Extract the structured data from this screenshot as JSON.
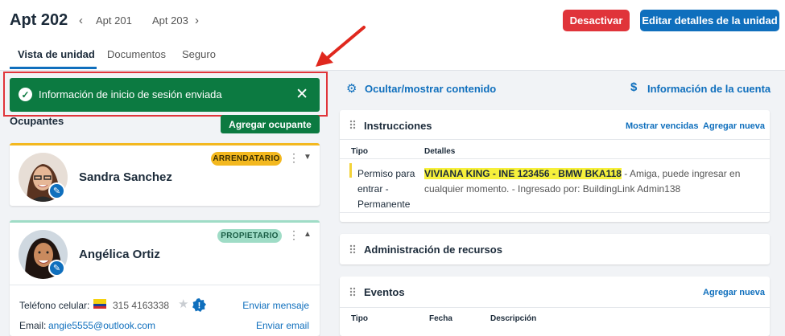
{
  "header": {
    "title": "Apt 202",
    "prev_unit": "Apt 201",
    "next_unit": "Apt 203",
    "deactivate_label": "Desactivar",
    "edit_label": "Editar detalles de la unidad"
  },
  "tabs": [
    {
      "label": "Vista de unidad",
      "active": true
    },
    {
      "label": "Documentos",
      "active": false
    },
    {
      "label": "Seguro",
      "active": false
    }
  ],
  "toast": {
    "message": "Información de inicio de sesión enviada",
    "close_icon": "close-icon"
  },
  "occupants": {
    "title": "Ocupantes",
    "add_label": "Agregar ocupante",
    "items": [
      {
        "name": "Sandra Sanchez",
        "role": "ARRENDATARIO",
        "expanded": false
      },
      {
        "name": "Angélica Ortiz",
        "role": "PROPIETARIO",
        "expanded": true,
        "phone_label": "Teléfono celular:",
        "phone": "315 4163338",
        "send_message": "Enviar mensaje",
        "email_label": "Email:",
        "email": "angie5555@outlook.com",
        "send_email": "Enviar email"
      }
    ]
  },
  "right": {
    "toggle_label": "Ocultar/mostrar contenido",
    "account_label": "Información de la cuenta",
    "instructions": {
      "title": "Instrucciones",
      "show_expired": "Mostrar vencidas",
      "add_new": "Agregar nueva",
      "col_type": "Tipo",
      "col_details": "Detalles",
      "rows": [
        {
          "type": "Permiso para entrar - Permanente",
          "highlight": "VIVIANA KING - INE 123456 - BMW BKA118",
          "detail_rest": " - Amiga, puede ingresar en cualquier momento.  - Ingresado por: BuildingLink Admin138"
        }
      ]
    },
    "resources": {
      "title": "Administración de recursos"
    },
    "events": {
      "title": "Eventos",
      "add_new": "Agregar nueva",
      "col_type": "Tipo",
      "col_date": "Fecha",
      "col_desc": "Descripción"
    }
  },
  "colors": {
    "primary": "#0f6fbd",
    "danger": "#e0343a",
    "success": "#0c7a41",
    "tenant_badge": "#f3b81f",
    "owner_badge": "#9fdcc6",
    "highlight": "#f6f03a"
  }
}
